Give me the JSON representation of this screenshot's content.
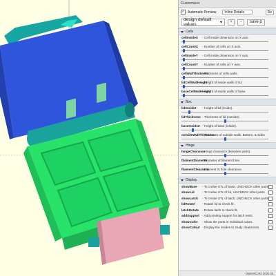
{
  "panel": {
    "title": "Customizer",
    "auto_preview_label": "Automatic Preview",
    "inline_details_value": "Inline Details",
    "reset_label": "Re",
    "preset_value": "design default values",
    "add_label": "+",
    "remove_label": "-",
    "save_label": "save p"
  },
  "sections": [
    {
      "title": "Cells",
      "params": [
        {
          "name": "cellInsideX",
          "desc": "- Cell inside dimension on X axis.",
          "kind": "slider",
          "value_frac": 0.02
        },
        {
          "name": "cellCountX",
          "desc": "- Number of cells on X axis.",
          "kind": "slider",
          "value_frac": 0.02
        },
        {
          "name": "cellInsideY",
          "desc": "- Cell inside dimension on Y axis.",
          "kind": "slider",
          "value_frac": 0.02
        },
        {
          "name": "cellCountY",
          "desc": "- Number of cells on Y axis.",
          "kind": "slider",
          "value_frac": 0.02
        },
        {
          "name": "cellWallThickness",
          "desc": "- Thickness of cells walls.",
          "kind": "slider",
          "value_frac": 0.02
        },
        {
          "name": "lidCellWallHeight",
          "desc": "- Height of inside walls of lid.",
          "kind": "slider",
          "value_frac": 0.02
        },
        {
          "name": "baseCellWallHeight",
          "desc": "- Height of inside walls of base.",
          "kind": "slider",
          "value_frac": 0.02
        }
      ]
    },
    {
      "title": "Box",
      "params": [
        {
          "name": "lidInsideZ",
          "desc": "- Height of lid (inside).",
          "kind": "slider",
          "value_frac": 0.08
        },
        {
          "name": "lidThickness",
          "desc": "- Thickness of lid (outside).",
          "kind": "slider",
          "value_frac": 0.5
        },
        {
          "name": "baseInsideZ",
          "desc": "- Height of base (inside).",
          "kind": "slider",
          "value_frac": 0.12
        },
        {
          "name": "outsideWallThickness",
          "desc": "- Thickness of outside walls. Bottom, & sides",
          "kind": "slider",
          "value_frac": 0.5
        }
      ]
    },
    {
      "title": "Hinge",
      "params": [
        {
          "name": "hingeClearance",
          "desc": "- Hinge clearance (between parts).",
          "kind": "slider",
          "value_frac": 0.5
        },
        {
          "name": "filamentDiameter",
          "desc": "- Diameter of filament hole.",
          "kind": "slider",
          "value_frac": 0.5
        },
        {
          "name": "filamentClearance",
          "desc": "- Filament to hole clearance.",
          "kind": "slider",
          "value_frac": 0.5
        }
      ]
    },
    {
      "title": "Display",
      "params": [
        {
          "name": "showBase",
          "desc": "- To create STL of base, UNCHECK other parts",
          "kind": "check"
        },
        {
          "name": "showLid",
          "desc": "- To create STL of lid, UNCHECK other parts",
          "kind": "check"
        },
        {
          "name": "showLatch",
          "desc": "- To create STL of latch, UNCHECK other parts",
          "kind": "check"
        },
        {
          "name": "lidRotate",
          "desc": "- Rotate lid to check fit.",
          "kind": "check"
        },
        {
          "name": "latchRotate",
          "desc": "- Rotate latch to check fit.",
          "kind": "check"
        },
        {
          "name": "addSupport",
          "desc": "- Add printing support for latch rests.",
          "kind": "check"
        },
        {
          "name": "showColor",
          "desc": "- Show the parts in individual colors.",
          "kind": "check"
        },
        {
          "name": "showCutout",
          "desc": "- Display the insides to study clearances.",
          "kind": "check"
        }
      ]
    }
  ],
  "status_text": "OpenSCAD 2021.01",
  "colors": {
    "viewport_bg": "#ffffe5",
    "lid_blue": "#2f4fd8",
    "base_green": "#27e36a",
    "hinge_teal": "#1aa7a7",
    "latch_pink": "#e9a6b4",
    "slider_thumb": "#2a57c9"
  }
}
